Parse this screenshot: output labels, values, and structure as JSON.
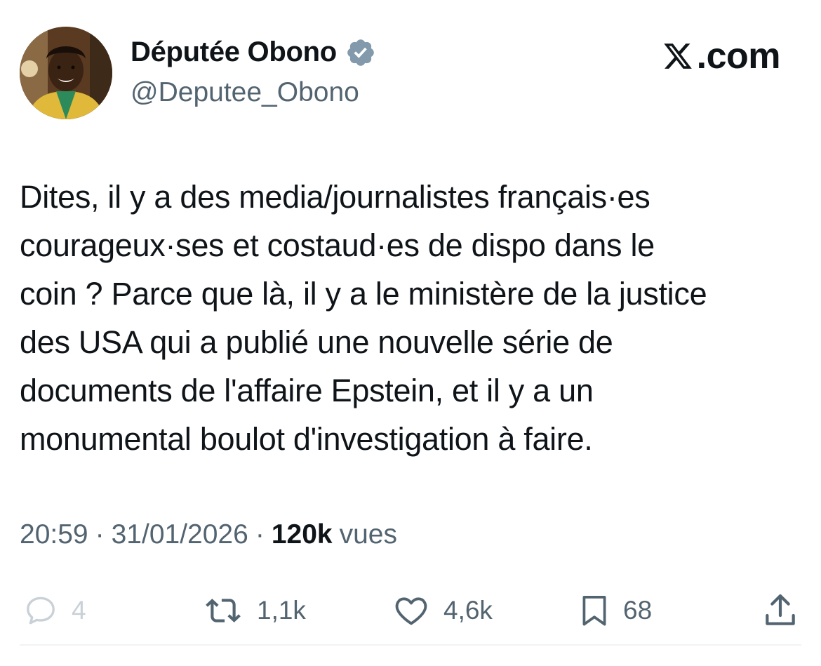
{
  "author": {
    "display_name": "Députée Obono",
    "handle": "@Deputee_Obono",
    "avatar_icon": "profile-photo",
    "verified_icon": "verified-badge-icon",
    "verified_color": "#829aab"
  },
  "brand": {
    "label": ".com",
    "icon": "x-logo-icon"
  },
  "tweet": {
    "text": "Dites, il y a des media/journalistes français·es\ncourageux·ses et costaud·es de dispo dans le\ncoin ? Parce que là, il y a le ministère de la justice\ndes USA qui a publié une nouvelle série de\ndocuments de l'affaire Epstein, et il y a un\nmonumental boulot d'investigation à faire."
  },
  "meta": {
    "time": "20:59",
    "date": "31/01/2026",
    "separator": "·",
    "views_count": "120k",
    "views_label": "vues"
  },
  "actions": {
    "reply": {
      "icon": "reply-icon",
      "count": "4"
    },
    "retweet": {
      "icon": "retweet-icon",
      "count": "1,1k"
    },
    "like": {
      "icon": "heart-icon",
      "count": "4,6k"
    },
    "bookmark": {
      "icon": "bookmark-icon",
      "count": "68"
    },
    "share": {
      "icon": "share-icon"
    }
  },
  "colors": {
    "text": "#0f1419",
    "secondary": "#536471",
    "faded": "#c9d1d7"
  }
}
